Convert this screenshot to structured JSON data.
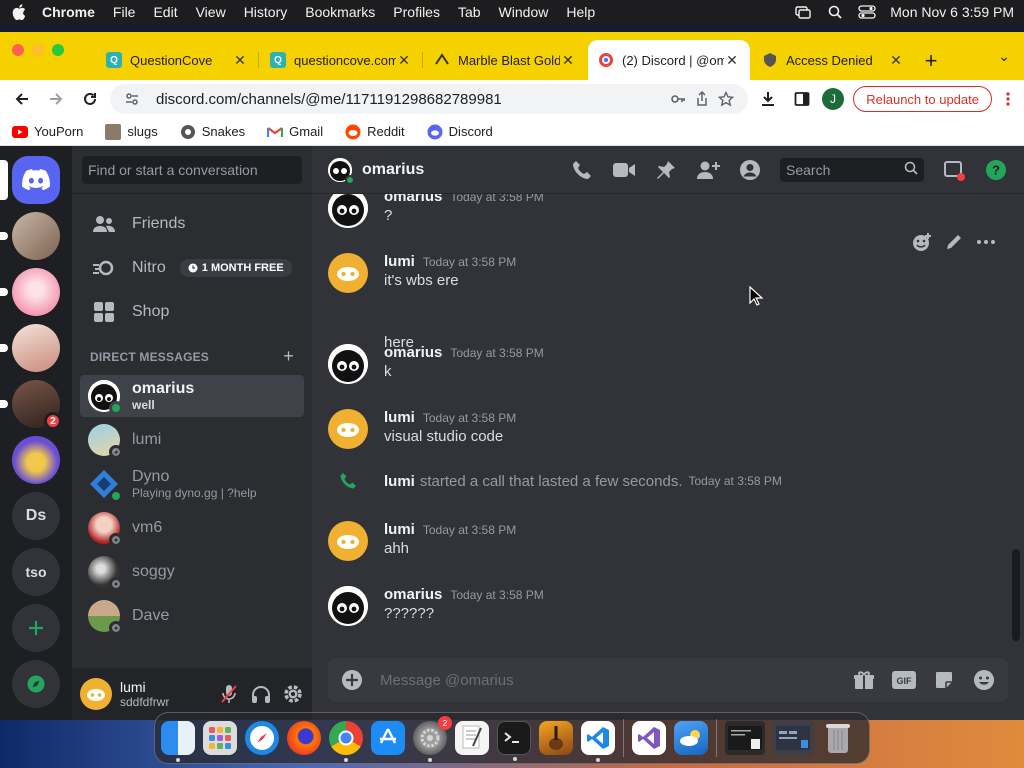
{
  "menubar": {
    "items": [
      "Chrome",
      "File",
      "Edit",
      "View",
      "History",
      "Bookmarks",
      "Profiles",
      "Tab",
      "Window",
      "Help"
    ],
    "clock": "Mon Nov 6  3:59 PM"
  },
  "tabs": [
    {
      "title": "QuestionCove",
      "icon": "questioncove-icon"
    },
    {
      "title": "questioncove.com",
      "icon": "questioncove-icon"
    },
    {
      "title": "Marble Blast Gold",
      "icon": "marble-icon"
    },
    {
      "title": "(2) Discord | @omarius",
      "icon": "discord-icon",
      "active": true
    },
    {
      "title": "Access Denied",
      "icon": "shield-icon"
    }
  ],
  "toolbar": {
    "url": "discord.com/channels/@me/1171191298682789981",
    "relaunch_label": "Relaunch to update",
    "profile_initial": "J"
  },
  "bookmarks": [
    "YouPorn",
    "slugs",
    "Snakes",
    "Gmail",
    "Reddit",
    "Discord"
  ],
  "servers": [
    {
      "type": "avatar",
      "color": "#b89a88"
    },
    {
      "type": "avatar",
      "color": "#f4a5b8"
    },
    {
      "type": "avatar",
      "color": "#e8c2b5"
    },
    {
      "type": "avatar",
      "color": "#5a3c30",
      "badge": "2"
    },
    {
      "type": "avatar",
      "color": "#6a4fd3"
    },
    {
      "type": "text",
      "label": "Ds"
    },
    {
      "type": "text",
      "label": "tso"
    }
  ],
  "sidebar": {
    "search_placeholder": "Find or start a conversation",
    "friends": "Friends",
    "nitro": "Nitro",
    "nitro_badge": "1 MONTH FREE",
    "shop": "Shop",
    "dm_header": "DIRECT MESSAGES",
    "dms": [
      {
        "name": "omarius",
        "sub": "well",
        "status": "online",
        "selected": true
      },
      {
        "name": "lumi",
        "sub": "",
        "status": "idle"
      },
      {
        "name": "Dyno",
        "sub": "Playing dyno.gg | ?help",
        "status": "online"
      },
      {
        "name": "vm6",
        "sub": "",
        "status": "idle"
      },
      {
        "name": "soggy",
        "sub": "",
        "status": "idle"
      },
      {
        "name": "Dave",
        "sub": "",
        "status": "idle"
      }
    ]
  },
  "user": {
    "name": "lumi",
    "tag": "sddfdfrwr"
  },
  "chat": {
    "title": "omarius",
    "search_placeholder": "Search",
    "composer_placeholder": "Message @omarius",
    "messages": [
      {
        "author": "omarius",
        "time": "Today at 3:58 PM",
        "text": "?",
        "avatar": "omarius"
      },
      {
        "author": "lumi",
        "time": "Today at 3:58 PM",
        "text": "it's wbs ere",
        "avatar": "lumi",
        "cont": "here"
      },
      {
        "author": "omarius",
        "time": "Today at 3:58 PM",
        "text": "k",
        "avatar": "omarius"
      },
      {
        "author": "lumi",
        "time": "Today at 3:58 PM",
        "text": "visual studio code",
        "avatar": "lumi"
      },
      {
        "author": "lumi",
        "time": "Today at 3:58 PM",
        "text": "ahh",
        "avatar": "lumi"
      },
      {
        "author": "omarius",
        "time": "Today at 3:58 PM",
        "text": "??????",
        "avatar": "omarius"
      }
    ],
    "system": {
      "who": "lumi",
      "text": "started a call that lasted a few seconds.",
      "time": "Today at 3:58 PM"
    }
  },
  "dock": {
    "settings_badge": "2"
  },
  "colors": {
    "discord_blurple": "#5865f2",
    "online": "#23a55a",
    "chrome_tabbar": "#f6d100",
    "relaunch": "#d93025"
  }
}
